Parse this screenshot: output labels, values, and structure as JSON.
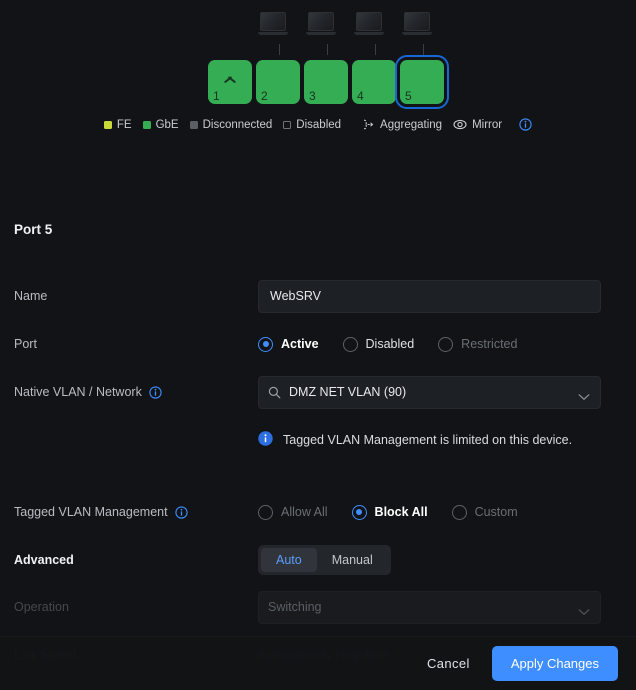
{
  "switch_diagram": {
    "ports": [
      {
        "num": "1",
        "state": "gbe",
        "icon": "uplink-chevron-icon",
        "selected": false,
        "device": false
      },
      {
        "num": "2",
        "state": "gbe",
        "icon": "",
        "selected": false,
        "device": true
      },
      {
        "num": "3",
        "state": "gbe",
        "icon": "",
        "selected": false,
        "device": true
      },
      {
        "num": "4",
        "state": "gbe",
        "icon": "",
        "selected": false,
        "device": true
      },
      {
        "num": "5",
        "state": "gbe",
        "icon": "",
        "selected": true,
        "device": true
      }
    ],
    "legend": [
      {
        "key": "fe",
        "label": "FE"
      },
      {
        "key": "gbe",
        "label": "GbE"
      },
      {
        "key": "disconnected",
        "label": "Disconnected"
      },
      {
        "key": "disabled",
        "label": "Disabled"
      },
      {
        "key": "aggregating",
        "label": "Aggregating"
      },
      {
        "key": "mirror",
        "label": "Mirror"
      }
    ]
  },
  "panel": {
    "title": "Port 5",
    "name": {
      "label": "Name",
      "value": "WebSRV",
      "placeholder": "Name"
    },
    "port_state": {
      "label": "Port",
      "options": [
        {
          "label": "Active",
          "selected": true,
          "disabled": false
        },
        {
          "label": "Disabled",
          "selected": false,
          "disabled": false
        },
        {
          "label": "Restricted",
          "selected": false,
          "disabled": true
        }
      ]
    },
    "native_vlan": {
      "label": "Native VLAN / Network",
      "value": "DMZ NET VLAN (90)"
    },
    "notice": {
      "text": "Tagged VLAN Management is limited on this device."
    },
    "tagged_vlan": {
      "label": "Tagged VLAN Management",
      "options": [
        {
          "label": "Allow All",
          "selected": false,
          "disabled": true
        },
        {
          "label": "Block All",
          "selected": true,
          "disabled": false
        },
        {
          "label": "Custom",
          "selected": false,
          "disabled": true
        }
      ]
    },
    "advanced": {
      "label": "Advanced",
      "segments": [
        {
          "label": "Auto",
          "active": true
        },
        {
          "label": "Manual",
          "active": false
        }
      ]
    },
    "operation": {
      "label": "Operation",
      "value": "Switching"
    },
    "link_speed": {
      "label": "Link Speed",
      "value": "Automatically Negotiate"
    }
  },
  "footer": {
    "cancel_label": "Cancel",
    "apply_label": "Apply Changes"
  },
  "colors": {
    "accent_blue": "#3e8eff",
    "gbe_green": "#35ad54",
    "fe_yellow": "#c9d93a",
    "background": "#111316"
  }
}
